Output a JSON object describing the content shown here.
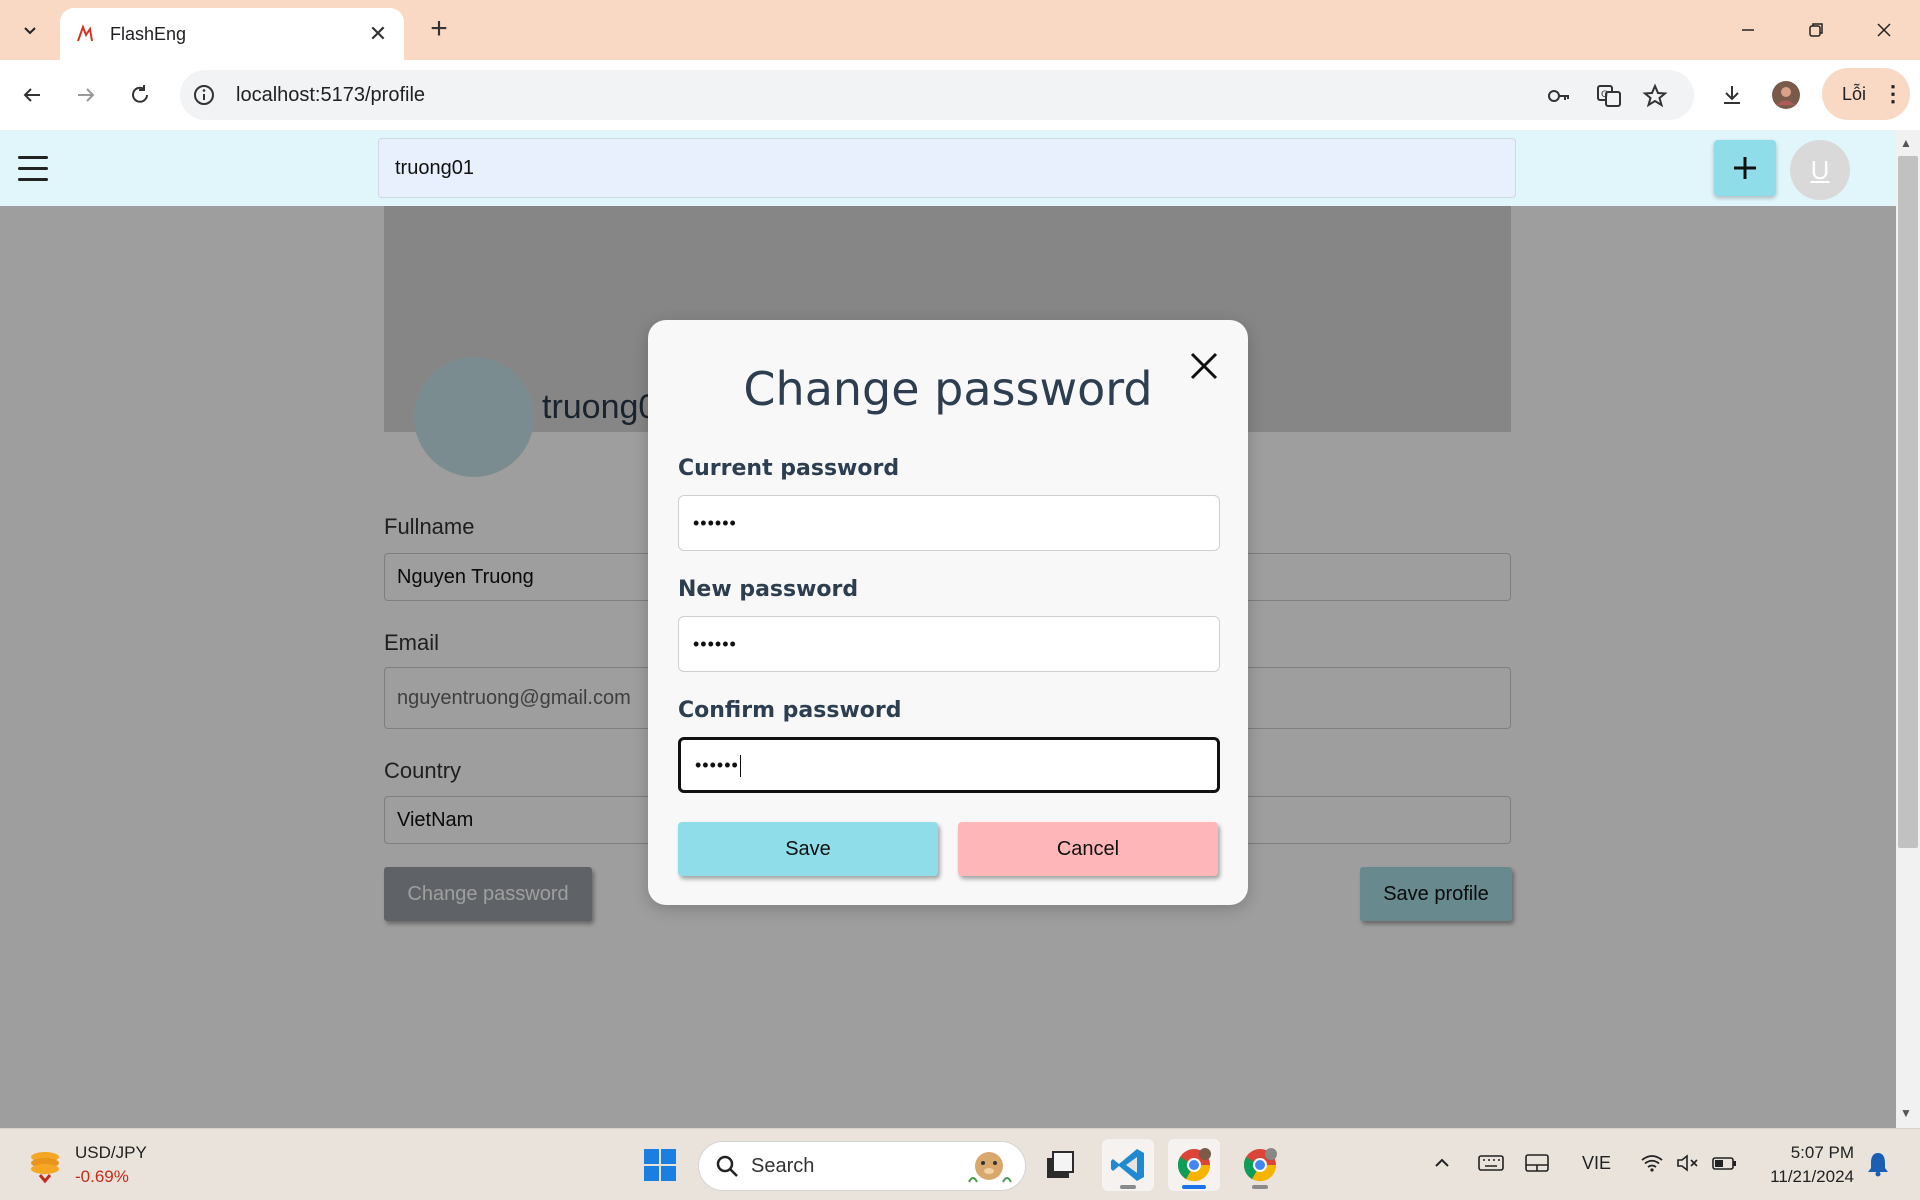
{
  "browser": {
    "tab_title": "FlashEng",
    "url": "localhost:5173/profile",
    "profile_label": "Lỗi"
  },
  "app": {
    "search_value": "truong01",
    "user_initial": "U"
  },
  "profile": {
    "username": "truong01",
    "fullname_label": "Fullname",
    "fullname_value": "Nguyen Truong",
    "email_label": "Email",
    "email_value": "nguyentruong@gmail.com",
    "country_label": "Country",
    "country_value": "VietNam",
    "change_password_label": "Change password",
    "save_profile_label": "Save profile"
  },
  "modal": {
    "title": "Change password",
    "current_label": "Current password",
    "current_value": "••••••",
    "new_label": "New password",
    "new_value": "••••••",
    "confirm_label": "Confirm password",
    "confirm_value": "••••••",
    "save_label": "Save",
    "cancel_label": "Cancel"
  },
  "taskbar": {
    "widget_title": "USD/JPY",
    "widget_change": "-0.69%",
    "search_placeholder": "Search",
    "language": "VIE",
    "time": "5:07 PM",
    "date": "11/21/2024"
  },
  "colors": {
    "tabstrip": "#f9d9c4",
    "app_header": "#e0f6fa",
    "save_button": "#8fdde9",
    "cancel_button": "#ffb6b9",
    "taskbar": "#e9e3dc"
  }
}
